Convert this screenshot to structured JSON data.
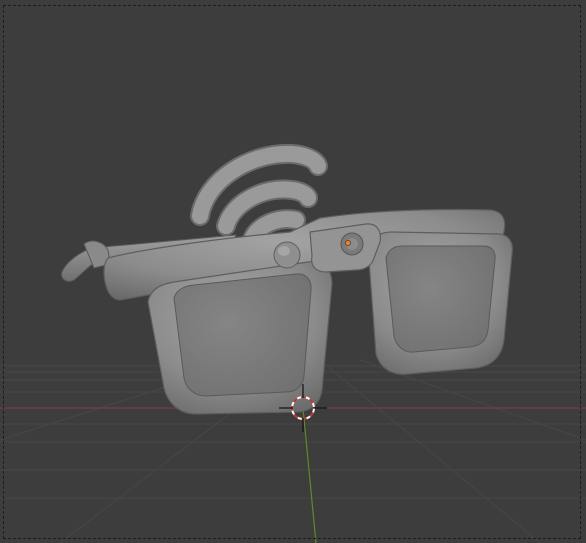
{
  "viewport": {
    "background": "#3d3d3d",
    "grid_color": "#4a4a4a",
    "x_axis_color": "#8c3a46",
    "y_axis_color": "#5f8a2a"
  },
  "scene": {
    "object": "smart-glasses-mesh",
    "mesh_color": "#8f8f8f",
    "lens_color": "#7d7d7d",
    "camera_dot_color": "#e8822a",
    "icons": [
      "wifi-signal-icon",
      "3d-cursor-icon",
      "camera-lens-icon"
    ]
  }
}
